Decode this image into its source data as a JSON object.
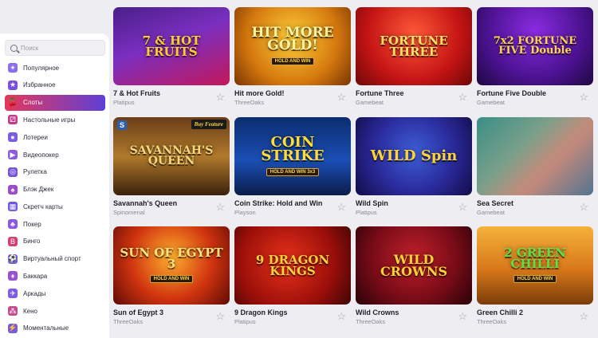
{
  "sidebar": {
    "search_placeholder": "Поиск",
    "items": [
      {
        "label": "Популярное",
        "icon": "gamepad-icon",
        "color": "#8e6cf0",
        "glyph": "✦"
      },
      {
        "label": "Избранное",
        "icon": "star-icon",
        "color": "#7a4fe0",
        "glyph": "★"
      },
      {
        "label": "Слоты",
        "icon": "cherries-icon",
        "color": "#ffffff",
        "glyph": "🍒",
        "active": true
      },
      {
        "label": "Настольные игры",
        "icon": "dice-icon",
        "color": "#c23a8a",
        "glyph": "⚂"
      },
      {
        "label": "Лотереи",
        "icon": "lottery-ball-icon",
        "color": "#7b5ee0",
        "glyph": "●"
      },
      {
        "label": "Видеопокер",
        "icon": "video-poker-icon",
        "color": "#8e5cd8",
        "glyph": "▶"
      },
      {
        "label": "Рулетка",
        "icon": "roulette-icon",
        "color": "#7a52d6",
        "glyph": "◎"
      },
      {
        "label": "Блэк Джек",
        "icon": "cards-icon",
        "color": "#9b4dc8",
        "glyph": "♠"
      },
      {
        "label": "Скретч карты",
        "icon": "scratch-card-icon",
        "color": "#6b5adf",
        "glyph": "▦"
      },
      {
        "label": "Покер",
        "icon": "poker-chip-icon",
        "color": "#8a58e2",
        "glyph": "♣"
      },
      {
        "label": "Бинго",
        "icon": "bingo-icon",
        "color": "#d6406e",
        "glyph": "B"
      },
      {
        "label": "Виртуальный спорт",
        "icon": "sport-controller-icon",
        "color": "#6f63e0",
        "glyph": "⚽"
      },
      {
        "label": "Баккара",
        "icon": "baccarat-icon",
        "color": "#9a52d0",
        "glyph": "♦"
      },
      {
        "label": "Аркады",
        "icon": "arcade-icon",
        "color": "#7f5be0",
        "glyph": "✈"
      },
      {
        "label": "Кено",
        "icon": "keno-grid-icon",
        "color": "#c44a8c",
        "glyph": "⁂"
      },
      {
        "label": "Моментальные",
        "icon": "lightning-icon",
        "color": "#7c5ad8",
        "glyph": "⚡"
      }
    ]
  },
  "games": [
    {
      "name": "7 & Hot Fruits",
      "provider": "Platipus",
      "art": "7 & HOT FRUITS",
      "bg": "linear-gradient(160deg,#4a1f8a,#7b2fbf 45%,#c2185b)",
      "fg": "#ffcc33",
      "size": 15
    },
    {
      "name": "Hit more Gold!",
      "provider": "ThreeOaks",
      "art": "HIT MORE GOLD!",
      "sub": "HOLD AND WIN",
      "bg": "radial-gradient(circle at 50% 40%,#ffcf3a,#d4780e 60%,#7a3504)",
      "fg": "#fff2a0",
      "size": 17
    },
    {
      "name": "Fortune Three",
      "provider": "Gamebeat",
      "art": "FORTUNE THREE",
      "bg": "radial-gradient(circle at 50% 35%,#ff5a3a,#c41414 60%,#6e0808)",
      "fg": "#ffe066",
      "size": 15
    },
    {
      "name": "Fortune Five Double",
      "provider": "Gamebeat",
      "art": "7x2 FORTUNE FIVE Double",
      "bg": "radial-gradient(circle at 50% 30%,#8a2be2,#4b1290 60%,#1e0840)",
      "fg": "#ffd451",
      "size": 13
    },
    {
      "name": "Savannah's Queen",
      "provider": "Spinomenal",
      "art": "SAVANNAH'S QUEEN",
      "badge": "Buy Feature",
      "corner": "S",
      "bg": "linear-gradient(180deg,#6a3d18,#b07a2c 50%,#3a210b)",
      "fg": "#f6d77a",
      "size": 14
    },
    {
      "name": "Coin Strike: Hold and Win",
      "provider": "Playson",
      "art": "COIN STRIKE",
      "sub": "HOLD AND WIN 3x3",
      "bg": "linear-gradient(180deg,#0b2d6e,#1b4fb5 55%,#0a1c4a)",
      "fg": "#ffdc3a",
      "size": 18
    },
    {
      "name": "Wild Spin",
      "provider": "Platipus",
      "art": "WILD Spin",
      "bg": "radial-gradient(circle at 50% 45%,#3d5fd8,#2a2a9a 55%,#120c48)",
      "fg": "#ffd23a",
      "size": 18
    },
    {
      "name": "Sea Secret",
      "provider": "Gamebeat",
      "art": "",
      "blur": true,
      "bg": "#3fa59a",
      "fg": "#ffffff",
      "size": 14
    },
    {
      "name": "Sun of Egypt 3",
      "provider": "ThreeOaks",
      "art": "SUN OF EGYPT 3",
      "sub": "HOLD AND WIN",
      "bg": "radial-gradient(circle at 50% 40%,#ffb02e,#d0340f 55%,#5e0b05)",
      "fg": "#ffe27a",
      "size": 15
    },
    {
      "name": "9 Dragon Kings",
      "provider": "Platipus",
      "art": "9 DRAGON KINGS",
      "bg": "radial-gradient(circle at 45% 45%,#e8321a,#9c0f0a 60%,#3e0505)",
      "fg": "#ffcf3e",
      "size": 15
    },
    {
      "name": "Wild Crowns",
      "provider": "ThreeOaks",
      "art": "WILD CROWNS",
      "bg": "radial-gradient(circle at 50% 40%,#c0202a,#7a0c18 55%,#2a0208)",
      "fg": "#ffd23a",
      "size": 16
    },
    {
      "name": "Green Chilli 2",
      "provider": "ThreeOaks",
      "art": "2 GREEN CHILLI",
      "sub": "HOLD AND WIN",
      "bg": "linear-gradient(180deg,#f5b23a,#d8781a 55%,#7a3c0a)",
      "fg": "#5fe04a",
      "size": 15
    }
  ],
  "favorite_glyph": "☆"
}
